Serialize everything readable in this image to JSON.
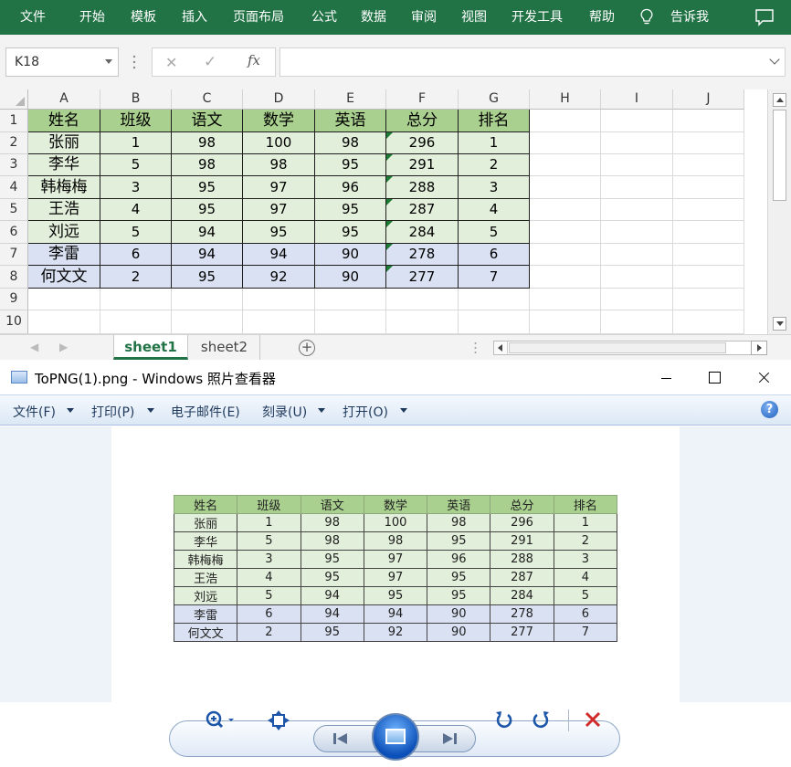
{
  "excel": {
    "ribbon_tabs": [
      "文件",
      "开始",
      "模板",
      "插入",
      "页面布局",
      "公式",
      "数据",
      "审阅",
      "视图",
      "开发工具",
      "帮助",
      "告诉我"
    ],
    "name_box": "K18",
    "formula_icons": [
      "cancel-icon",
      "enter-icon",
      "fx-icon"
    ],
    "columns": [
      "A",
      "B",
      "C",
      "D",
      "E",
      "F",
      "G",
      "H",
      "I",
      "J"
    ],
    "rows": [
      "1",
      "2",
      "3",
      "4",
      "5",
      "6",
      "7",
      "8",
      "9",
      "10"
    ],
    "table": {
      "headers": [
        "姓名",
        "班级",
        "语文",
        "数学",
        "英语",
        "总分",
        "排名"
      ],
      "rows": [
        [
          "张丽",
          "1",
          "98",
          "100",
          "98",
          "296",
          "1"
        ],
        [
          "李华",
          "5",
          "98",
          "98",
          "95",
          "291",
          "2"
        ],
        [
          "韩梅梅",
          "3",
          "95",
          "97",
          "96",
          "288",
          "3"
        ],
        [
          "王浩",
          "4",
          "95",
          "97",
          "95",
          "287",
          "4"
        ],
        [
          "刘远",
          "5",
          "94",
          "95",
          "95",
          "284",
          "5"
        ],
        [
          "李雷",
          "6",
          "94",
          "94",
          "90",
          "278",
          "6"
        ],
        [
          "何文文",
          "2",
          "95",
          "92",
          "90",
          "277",
          "7"
        ]
      ]
    },
    "sheets": [
      "sheet1",
      "sheet2"
    ],
    "active_sheet": "sheet1",
    "colors": {
      "ribbon": "#217346",
      "header_fill": "#a9d08e",
      "green_fill": "#e2efda",
      "blue_fill": "#d9e1f2"
    }
  },
  "viewer": {
    "title": "ToPNG(1).png - Windows 照片查看器",
    "menu": [
      {
        "label": "文件(F)",
        "dropdown": true
      },
      {
        "label": "打印(P)",
        "dropdown": true
      },
      {
        "label": "电子邮件(E)",
        "dropdown": false
      },
      {
        "label": "刻录(U)",
        "dropdown": true
      },
      {
        "label": "打开(O)",
        "dropdown": true
      }
    ],
    "help": "?",
    "toolbar_icons": [
      "zoom-icon",
      "actual-size-icon",
      "previous-icon",
      "slideshow-icon",
      "next-icon",
      "rotate-left-icon",
      "rotate-right-icon",
      "delete-icon"
    ]
  }
}
